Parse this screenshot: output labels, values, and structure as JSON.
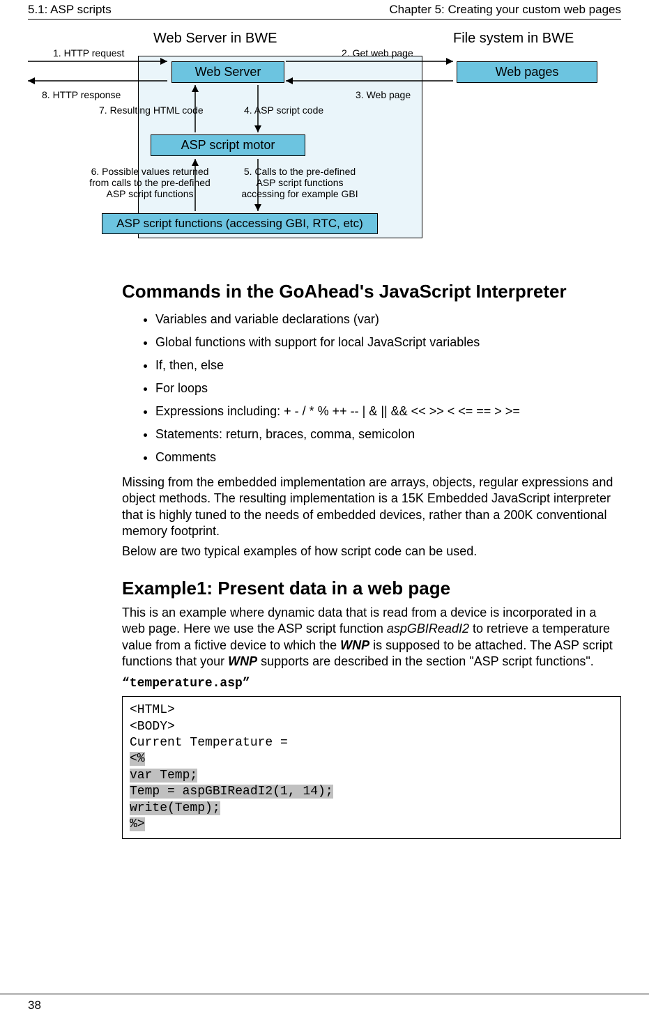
{
  "header": {
    "left": "5.1: ASP scripts",
    "right": "Chapter 5: Creating your custom web pages"
  },
  "footer": {
    "page": "38"
  },
  "diagram": {
    "title_left": "Web Server in BWE",
    "title_right": "File system in BWE",
    "box_webserver": "Web Server",
    "box_aspmotor": "ASP script motor",
    "box_funcs": "ASP script functions (accessing GBI, RTC, etc)",
    "box_webpages": "Web pages",
    "lbl1": "1. HTTP request",
    "lbl2": "2. Get web page",
    "lbl3": "3. Web page",
    "lbl4": "4. ASP script code",
    "lbl5": "5. Calls to the pre-defined ASP script functions accessing for example GBI",
    "lbl6": "6. Possible values returned from calls to the pre-defined ASP script functions",
    "lbl7": "7. Resulting HTML code",
    "lbl8": "8. HTTP response"
  },
  "sec1": {
    "title": "Commands in the GoAhead's JavaScript Interpreter",
    "items": [
      "Variables and variable declarations (var)",
      "Global functions with support for local JavaScript variables",
      "If, then, else",
      "For loops",
      "Expressions including: + - / * % ++ -- | & || && << >> < <= == > >=",
      "Statements: return, braces, comma, semicolon",
      "Comments"
    ],
    "para1": "Missing from the embedded implementation are arrays, objects, regular expressions and object methods. The resulting implementation is a 15K Embedded JavaScript interpreter that is highly tuned to the needs of embedded devices, rather than a 200K conventional memory footprint.",
    "para2": "Below are two typical examples of how script code can be used."
  },
  "sec2": {
    "title": "Example1: Present data in a web page",
    "intro_a": "This is an example where dynamic data that is read from a device is incorporated in a web page. Here we use the ASP script function ",
    "intro_fn": "aspGBIReadI2",
    "intro_b": " to retrieve a temperature value from a fictive device to which the ",
    "intro_wnp": "WNP",
    "intro_c": " is supposed to be attached. The ASP script functions that your ",
    "intro_d": " supports are described in the section \"ASP script functions\".",
    "filename": "“temperature.asp”",
    "code": {
      "l1": "<HTML>",
      "l2": "<BODY>",
      "l3": "Current Temperature =",
      "l4": "<%",
      "l5": "var Temp;",
      "l6": "Temp = aspGBIReadI2(1, 14);",
      "l7": "write(Temp);",
      "l8": "%>"
    }
  }
}
